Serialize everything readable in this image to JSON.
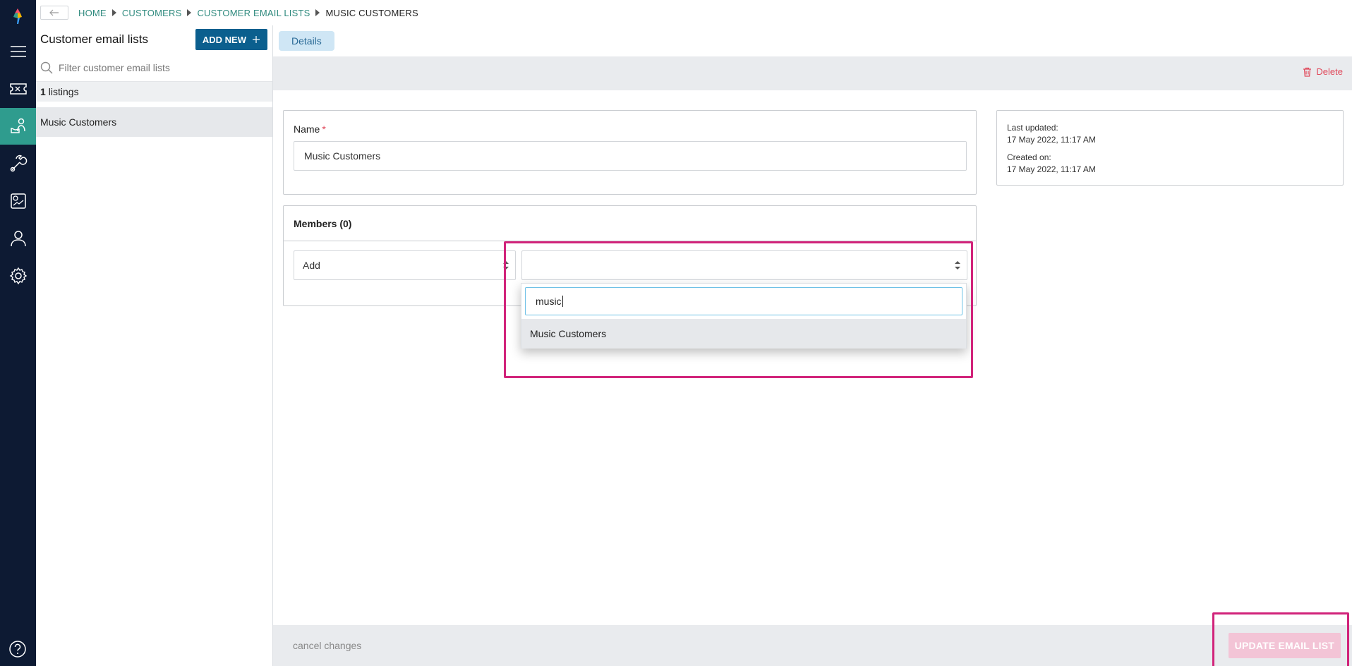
{
  "breadcrumb": {
    "items": [
      "HOME",
      "CUSTOMERS",
      "CUSTOMER EMAIL LISTS"
    ],
    "current": "MUSIC CUSTOMERS"
  },
  "list_panel": {
    "title": "Customer email lists",
    "add_new_label": "ADD NEW",
    "filter_placeholder": "Filter customer email lists",
    "count": "1",
    "count_label": "listings",
    "items": [
      "Music Customers"
    ]
  },
  "main": {
    "tab_label": "Details",
    "delete_label": "Delete",
    "name_label": "Name",
    "required_mark": "*",
    "name_value": "Music Customers",
    "meta": {
      "last_updated_label": "Last updated:",
      "last_updated_value": "17 May 2022, 11:17 AM",
      "created_label": "Created on:",
      "created_value": "17 May 2022, 11:17 AM"
    },
    "members_title": "Members (0)",
    "add_select_value": "Add",
    "dropdown": {
      "search_value": "music",
      "options": [
        "Music Customers"
      ]
    }
  },
  "footer": {
    "cancel_label": "cancel changes",
    "update_label": "UPDATE EMAIL LIST"
  },
  "colors": {
    "rail": "#0d1a33",
    "rail_active": "#2f9c8e",
    "primary_button": "#0b5f8e",
    "highlight": "#d1237a",
    "danger": "#e0485a"
  }
}
